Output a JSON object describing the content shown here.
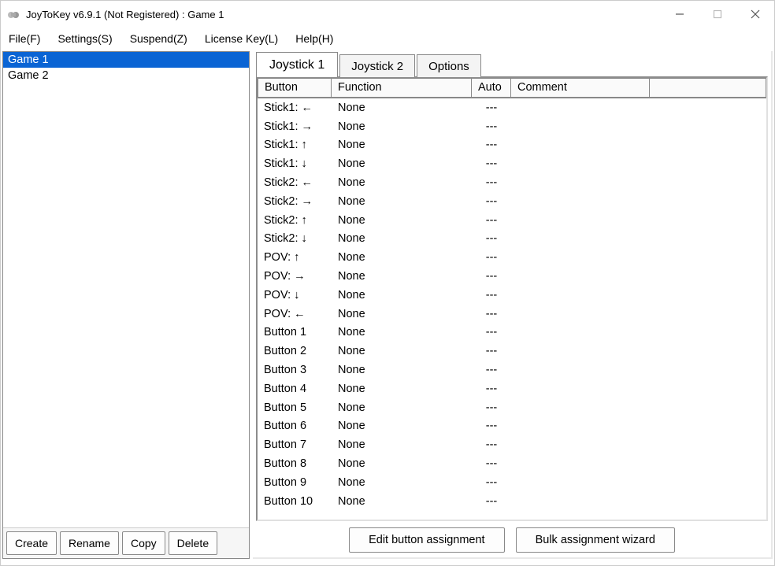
{
  "window": {
    "title": "JoyToKey v6.9.1 (Not Registered) : Game 1"
  },
  "menu": {
    "file": "File(F)",
    "settings": "Settings(S)",
    "suspend": "Suspend(Z)",
    "license": "License Key(L)",
    "help": "Help(H)"
  },
  "profiles": [
    {
      "name": "Game 1",
      "selected": true
    },
    {
      "name": "Game 2",
      "selected": false
    }
  ],
  "profile_buttons": {
    "create": "Create",
    "rename": "Rename",
    "copy": "Copy",
    "delete": "Delete"
  },
  "tabs": {
    "joy1": "Joystick 1",
    "joy2": "Joystick 2",
    "options": "Options"
  },
  "table": {
    "headers": {
      "button": "Button",
      "function": "Function",
      "auto": "Auto",
      "comment": "Comment"
    },
    "rows": [
      {
        "button": "Stick1: ←",
        "function": "None",
        "auto": "---",
        "comment": ""
      },
      {
        "button": "Stick1: →",
        "function": "None",
        "auto": "---",
        "comment": ""
      },
      {
        "button": "Stick1: ↑",
        "function": "None",
        "auto": "---",
        "comment": ""
      },
      {
        "button": "Stick1: ↓",
        "function": "None",
        "auto": "---",
        "comment": ""
      },
      {
        "button": "Stick2: ←",
        "function": "None",
        "auto": "---",
        "comment": ""
      },
      {
        "button": "Stick2: →",
        "function": "None",
        "auto": "---",
        "comment": ""
      },
      {
        "button": "Stick2: ↑",
        "function": "None",
        "auto": "---",
        "comment": ""
      },
      {
        "button": "Stick2: ↓",
        "function": "None",
        "auto": "---",
        "comment": ""
      },
      {
        "button": "POV: ↑",
        "function": "None",
        "auto": "---",
        "comment": ""
      },
      {
        "button": "POV: →",
        "function": "None",
        "auto": "---",
        "comment": ""
      },
      {
        "button": "POV: ↓",
        "function": "None",
        "auto": "---",
        "comment": ""
      },
      {
        "button": "POV: ←",
        "function": "None",
        "auto": "---",
        "comment": ""
      },
      {
        "button": "Button 1",
        "function": "None",
        "auto": "---",
        "comment": ""
      },
      {
        "button": "Button 2",
        "function": "None",
        "auto": "---",
        "comment": ""
      },
      {
        "button": "Button 3",
        "function": "None",
        "auto": "---",
        "comment": ""
      },
      {
        "button": "Button 4",
        "function": "None",
        "auto": "---",
        "comment": ""
      },
      {
        "button": "Button 5",
        "function": "None",
        "auto": "---",
        "comment": ""
      },
      {
        "button": "Button 6",
        "function": "None",
        "auto": "---",
        "comment": ""
      },
      {
        "button": "Button 7",
        "function": "None",
        "auto": "---",
        "comment": ""
      },
      {
        "button": "Button 8",
        "function": "None",
        "auto": "---",
        "comment": ""
      },
      {
        "button": "Button 9",
        "function": "None",
        "auto": "---",
        "comment": ""
      },
      {
        "button": "Button 10",
        "function": "None",
        "auto": "---",
        "comment": ""
      }
    ]
  },
  "assign_buttons": {
    "edit": "Edit button assignment",
    "bulk": "Bulk assignment wizard"
  }
}
